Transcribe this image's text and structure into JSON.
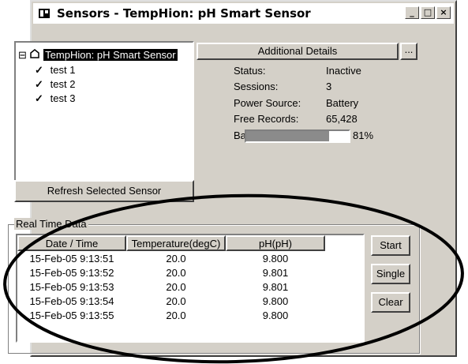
{
  "window": {
    "title": "Sensors - TempHion: pH Smart Sensor",
    "minimize": "_",
    "maximize": "□",
    "close": "×"
  },
  "tree": {
    "root": "TempHion: pH Smart Sensor",
    "expander": "⊟",
    "children": [
      "test 1",
      "test 2",
      "test 3"
    ],
    "check_glyph": "✓"
  },
  "refresh_button": "Refresh Selected Sensor",
  "details": {
    "button": "Additional Details",
    "ellipsis": "...",
    "rows": [
      {
        "label": "Status:",
        "value": "Inactive"
      },
      {
        "label": "Sessions:",
        "value": "3"
      },
      {
        "label": "Power Source:",
        "value": "Battery"
      },
      {
        "label": "Free Records:",
        "value": "65,428"
      }
    ],
    "battery_label": "Battery",
    "battery_percent_text": "81%",
    "battery_level": 0.81
  },
  "realtime": {
    "group_label": "Real Time Data",
    "columns": [
      "Date / Time",
      "Temperature(degC)",
      "pH(pH)"
    ],
    "rows": [
      [
        "15-Feb-05  9:13:51",
        "20.0",
        "9.800"
      ],
      [
        "15-Feb-05  9:13:52",
        "20.0",
        "9.801"
      ],
      [
        "15-Feb-05  9:13:53",
        "20.0",
        "9.801"
      ],
      [
        "15-Feb-05  9:13:54",
        "20.0",
        "9.800"
      ],
      [
        "15-Feb-05  9:13:55",
        "20.0",
        "9.800"
      ]
    ],
    "buttons": {
      "start": "Start",
      "single": "Single",
      "clear": "Clear"
    }
  }
}
